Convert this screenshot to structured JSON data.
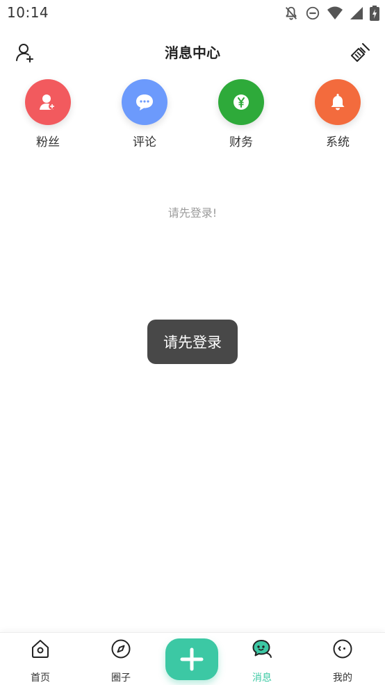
{
  "status_bar": {
    "time": "10:14",
    "icons": [
      "notifications-off-icon",
      "do-not-disturb-icon",
      "wifi-icon",
      "signal-icon",
      "battery-charging-icon"
    ]
  },
  "header": {
    "title": "消息中心",
    "left_icon": "add-user-icon",
    "right_icon": "broom-clear-icon"
  },
  "categories": [
    {
      "label": "粉丝",
      "icon": "fans-icon",
      "color": "#f25a5e"
    },
    {
      "label": "评论",
      "icon": "comment-icon",
      "color": "#6c9afc"
    },
    {
      "label": "财务",
      "icon": "finance-yen-icon",
      "color": "#2eaa3a"
    },
    {
      "label": "系统",
      "icon": "bell-icon",
      "color": "#f36b3d"
    }
  ],
  "empty_message": "请先登录!",
  "toast": "请先登录",
  "bottom_nav": {
    "items": [
      {
        "label": "首页",
        "icon": "home-icon"
      },
      {
        "label": "圈子",
        "icon": "compass-icon"
      },
      {
        "label": "消息",
        "icon": "message-icon",
        "active": true
      },
      {
        "label": "我的",
        "icon": "profile-face-icon"
      }
    ],
    "center_button_icon": "plus-icon"
  },
  "colors": {
    "accent": "#3cc8a4",
    "toast_bg": "#484848",
    "muted_text": "#9b9b9b"
  }
}
